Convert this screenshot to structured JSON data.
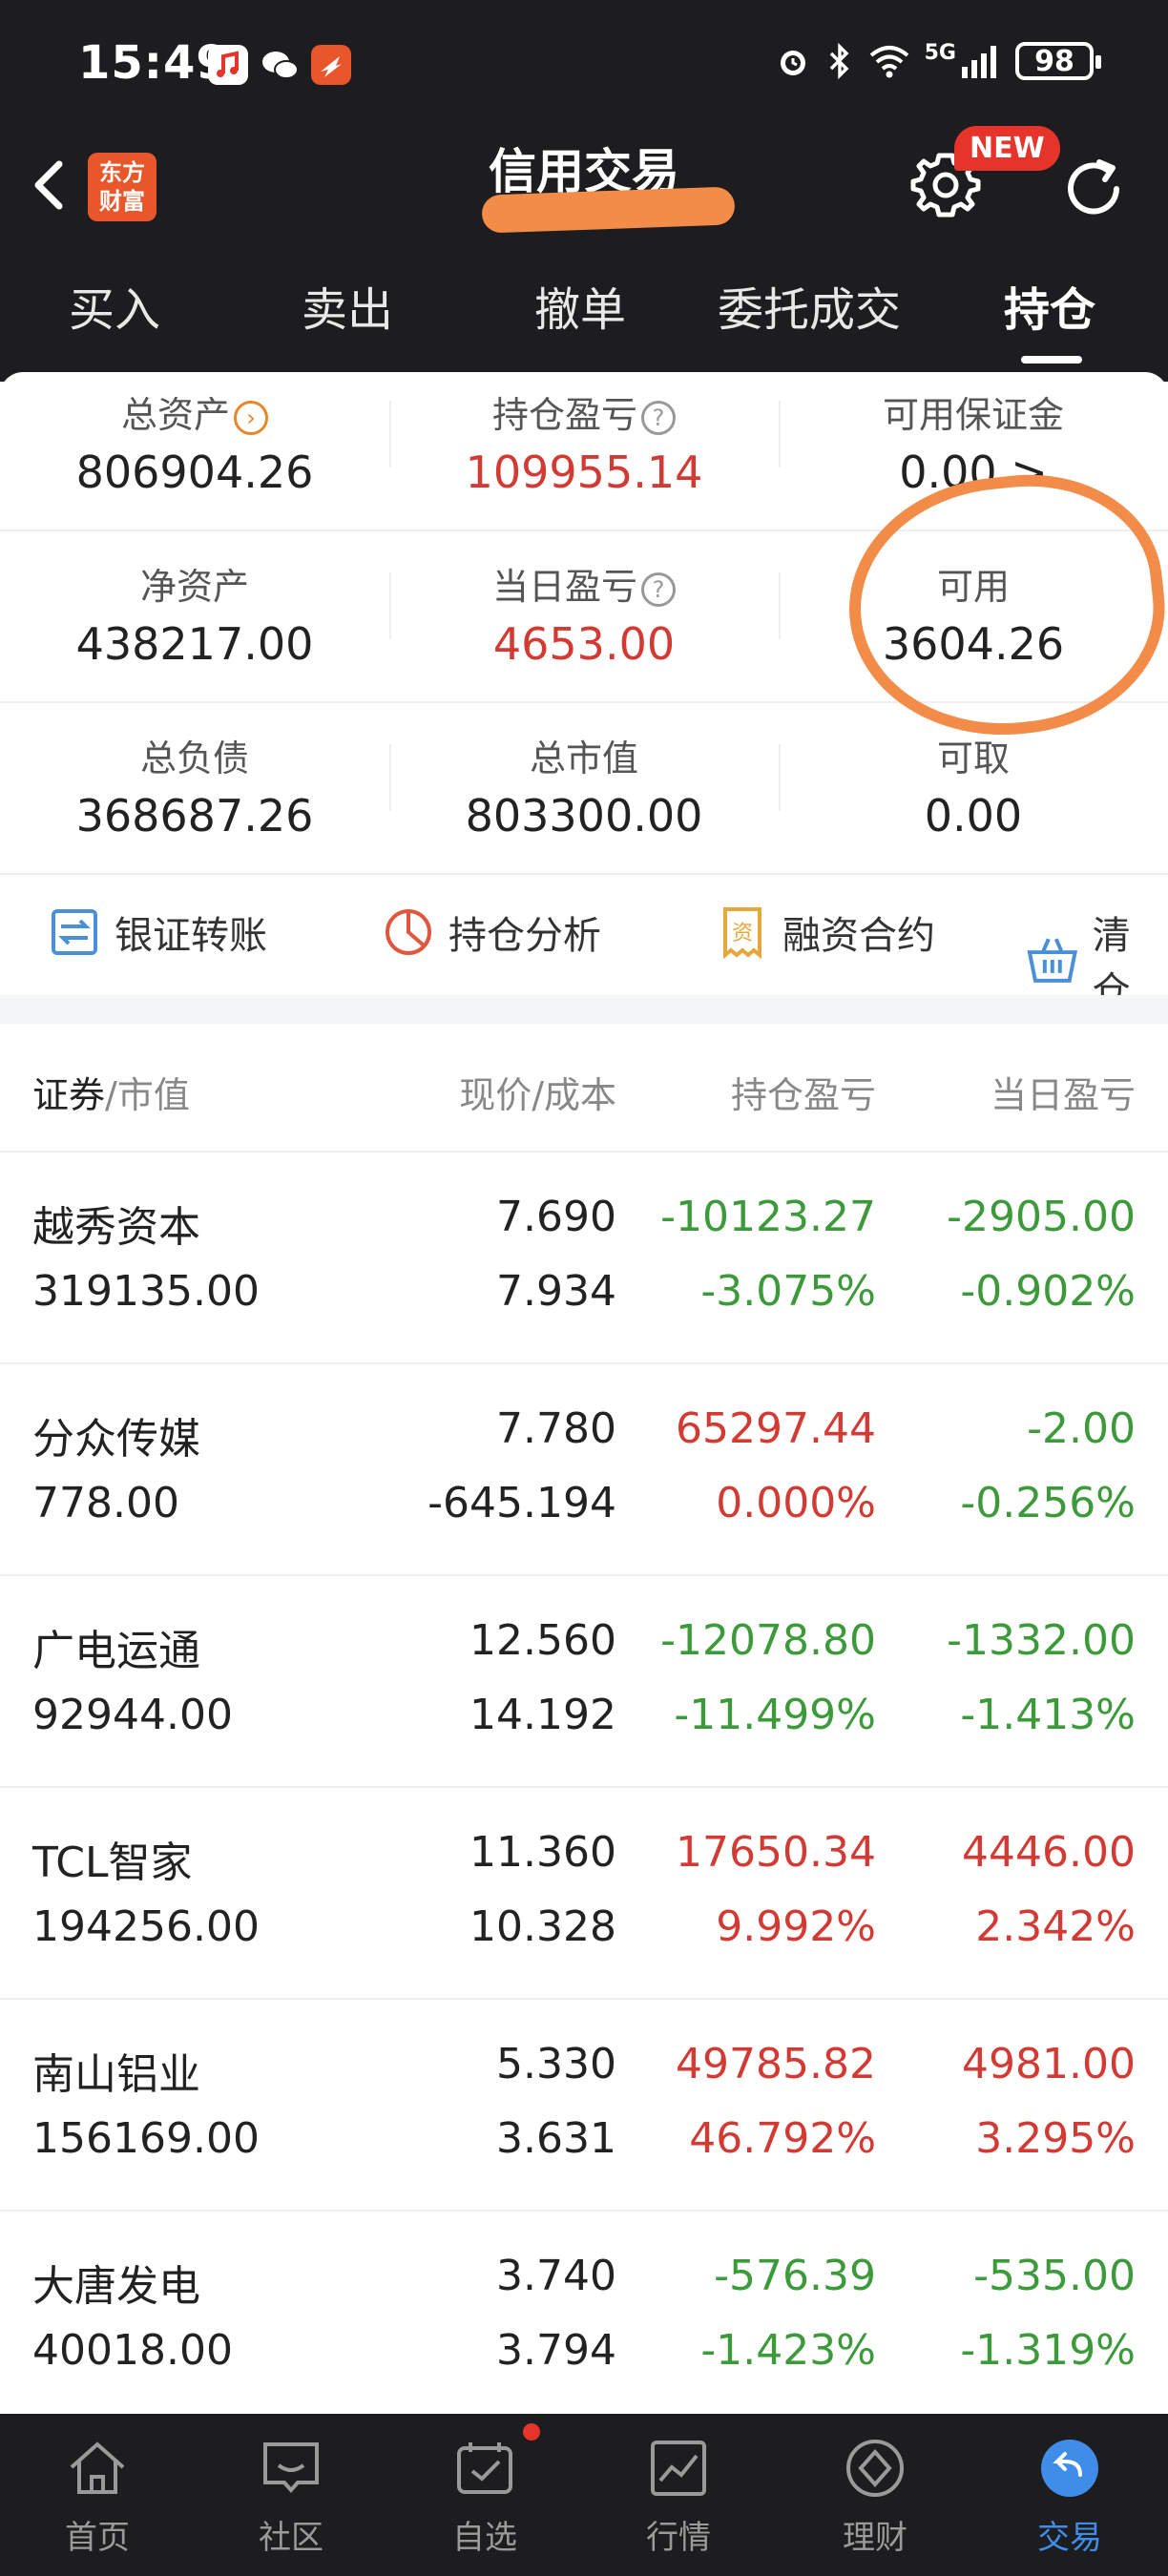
{
  "status_bar": {
    "time": "15:49",
    "network": "5G",
    "battery": "98",
    "icons": [
      "music-app-icon",
      "wechat-icon",
      "fire-app-icon",
      "alarm-icon",
      "bluetooth-icon",
      "wifi-icon",
      "signal-icon",
      "battery-icon"
    ]
  },
  "header": {
    "title": "信用交易",
    "logo_line1": "东方",
    "logo_line2": "财富",
    "new_badge": "NEW"
  },
  "tabs": [
    {
      "label": "买入",
      "active": false
    },
    {
      "label": "卖出",
      "active": false
    },
    {
      "label": "撤单",
      "active": false
    },
    {
      "label": "委托成交",
      "active": false
    },
    {
      "label": "持仓",
      "active": true
    }
  ],
  "summary": {
    "total_assets": {
      "label": "总资产",
      "value": "806904.26"
    },
    "position_pnl": {
      "label": "持仓盈亏",
      "value": "109955.14"
    },
    "available_margin": {
      "label": "可用保证金",
      "value": "0.00 >"
    },
    "net_assets": {
      "label": "净资产",
      "value": "438217.00"
    },
    "daily_pnl": {
      "label": "当日盈亏",
      "value": "4653.00"
    },
    "available": {
      "label": "可用",
      "value": "3604.26"
    },
    "total_liabilities": {
      "label": "总负债",
      "value": "368687.26"
    },
    "total_market_value": {
      "label": "总市值",
      "value": "803300.00"
    },
    "withdrawable": {
      "label": "可取",
      "value": "0.00"
    }
  },
  "actions": [
    {
      "label": "银证转账",
      "icon": "transfer-icon"
    },
    {
      "label": "持仓分析",
      "icon": "pie-chart-icon"
    },
    {
      "label": "融资合约",
      "icon": "contract-icon"
    },
    {
      "label": "清仓",
      "icon": "basket-icon"
    }
  ],
  "table": {
    "headers": {
      "security": "证券",
      "market_value": "/市值",
      "price_cost": "现价/成本",
      "position_pnl": "持仓盈亏",
      "daily_pnl": "当日盈亏"
    },
    "rows": [
      {
        "name": "越秀资本",
        "market_value": "319135.00",
        "price": "7.690",
        "cost": "7.934",
        "pnl": "-10123.27",
        "pnl_pct": "-3.075%",
        "day": "-2905.00",
        "day_pct": "-0.902%"
      },
      {
        "name": "分众传媒",
        "market_value": "778.00",
        "price": "7.780",
        "cost": "-645.194",
        "pnl": "65297.44",
        "pnl_pct": "0.000%",
        "day": "-2.00",
        "day_pct": "-0.256%"
      },
      {
        "name": "广电运通",
        "market_value": "92944.00",
        "price": "12.560",
        "cost": "14.192",
        "pnl": "-12078.80",
        "pnl_pct": "-11.499%",
        "day": "-1332.00",
        "day_pct": "-1.413%"
      },
      {
        "name": "TCL智家",
        "market_value": "194256.00",
        "price": "11.360",
        "cost": "10.328",
        "pnl": "17650.34",
        "pnl_pct": "9.992%",
        "day": "4446.00",
        "day_pct": "2.342%"
      },
      {
        "name": "南山铝业",
        "market_value": "156169.00",
        "price": "5.330",
        "cost": "3.631",
        "pnl": "49785.82",
        "pnl_pct": "46.792%",
        "day": "4981.00",
        "day_pct": "3.295%"
      },
      {
        "name": "大唐发电",
        "market_value": "40018.00",
        "price": "3.740",
        "cost": "3.794",
        "pnl": "-576.39",
        "pnl_pct": "-1.423%",
        "day": "-535.00",
        "day_pct": "-1.319%"
      }
    ]
  },
  "bottom_nav": [
    {
      "label": "首页",
      "icon": "home-icon",
      "active": false
    },
    {
      "label": "社区",
      "icon": "chat-icon",
      "active": false
    },
    {
      "label": "自选",
      "icon": "watchlist-icon",
      "active": false
    },
    {
      "label": "行情",
      "icon": "market-chart-icon",
      "active": false
    },
    {
      "label": "理财",
      "icon": "diamond-icon",
      "active": false
    },
    {
      "label": "交易",
      "icon": "trade-icon",
      "active": true
    }
  ],
  "colors": {
    "up": "#d23a33",
    "down": "#3d9a3a",
    "accent": "#3f8de8",
    "header_bg": "#1d1d1f",
    "annotation": "#f28c48"
  }
}
